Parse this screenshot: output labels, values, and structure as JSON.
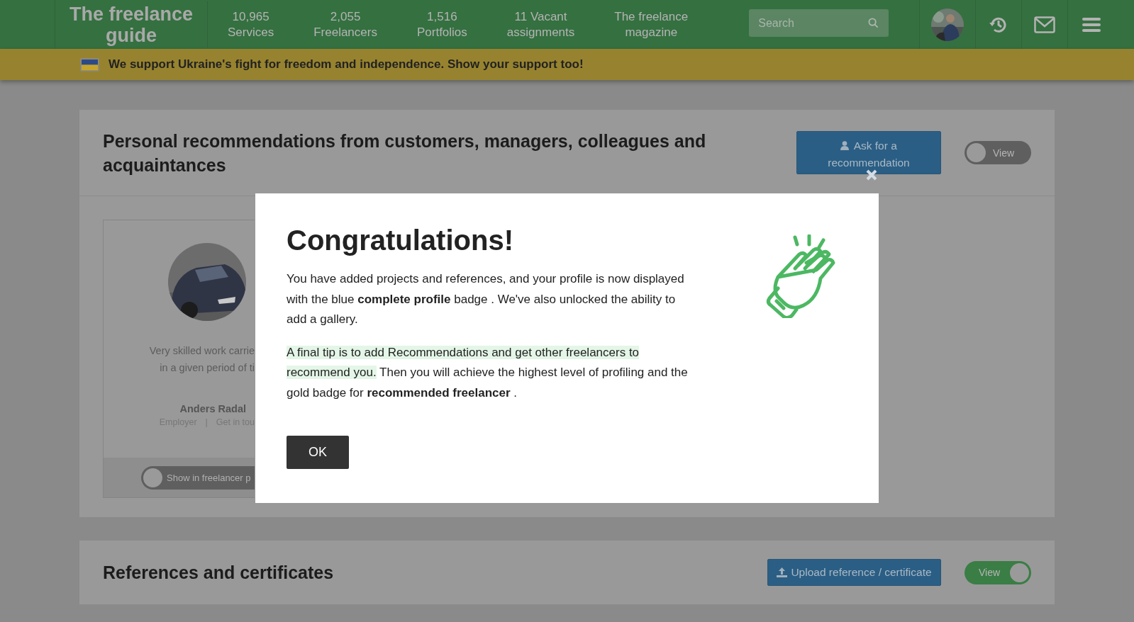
{
  "header": {
    "logo": "The freelance guide",
    "nav": [
      {
        "count": "10,965",
        "label": "Services"
      },
      {
        "count": "2,055",
        "label": "Freelancers"
      },
      {
        "count": "1,516",
        "label": "Portfolios"
      },
      {
        "count": "11 Vacant",
        "label": "assignments"
      },
      {
        "count": "The freelance",
        "label": "magazine"
      }
    ],
    "search": {
      "placeholder": "Search"
    }
  },
  "banner": {
    "text": "We support Ukraine's fight for freedom and independence. Show your support too!"
  },
  "sections": [
    {
      "title": "Personal recommendations from customers, managers, colleagues and acquaintances",
      "button": {
        "label": "Ask for a recommendation"
      },
      "toggle": {
        "label": "View",
        "on": false
      },
      "recommendation": {
        "text": "Very skilled work carrie\nin a given period of ti",
        "name": "Anders Radal",
        "role": "Employer",
        "separator": "|",
        "link": "Get in tou",
        "toggle": {
          "label": "Show in freelancer p",
          "on": false
        }
      }
    },
    {
      "title": "References and certificates",
      "button": {
        "label": "Upload reference / certificate"
      },
      "toggle": {
        "label": "View",
        "on": true
      }
    }
  ],
  "modal": {
    "title": "Congratulations!",
    "paragraph": "You have added projects and references, and your profile is now displayed with the blue **complete profile** badge . We've also unlocked the ability to add a gallery.",
    "tip": {
      "highlighted": "A final tip is to add Recommendations and get other freelancers to recommend you.",
      "text": " Then you will achieve the highest level of profiling and the gold badge for **recommended freelancer** ."
    },
    "button": "OK"
  }
}
